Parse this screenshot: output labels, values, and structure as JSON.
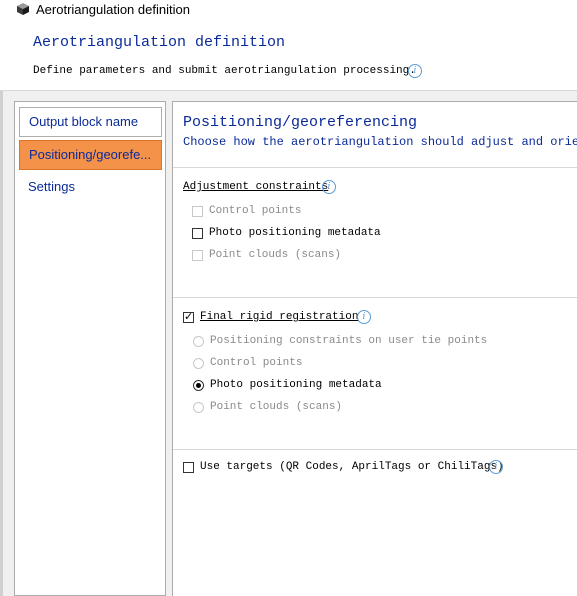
{
  "window": {
    "title": "Aerotriangulation definition"
  },
  "header": {
    "title": "Aerotriangulation definition",
    "subtitle": "Define parameters and submit aerotriangulation processing."
  },
  "sidebar": {
    "items": [
      {
        "label": "Output block name"
      },
      {
        "label": "Positioning/georefe..."
      },
      {
        "label": "Settings"
      }
    ]
  },
  "page": {
    "title": "Positioning/georeferencing",
    "subtitle": "Choose how the aerotriangulation should adjust and orient"
  },
  "adjustment": {
    "label": "Adjustment constraints",
    "options": [
      {
        "label": "Control points",
        "checked": false,
        "enabled": false
      },
      {
        "label": "Photo positioning metadata",
        "checked": false,
        "enabled": true
      },
      {
        "label": "Point clouds (scans)",
        "checked": false,
        "enabled": false
      }
    ]
  },
  "final_registration": {
    "label": "Final rigid registration",
    "checked": true,
    "options": [
      {
        "label": "Positioning constraints on user tie points",
        "selected": false,
        "enabled": false
      },
      {
        "label": "Control points",
        "selected": false,
        "enabled": false
      },
      {
        "label": "Photo positioning metadata",
        "selected": true,
        "enabled": true
      },
      {
        "label": "Point clouds (scans)",
        "selected": false,
        "enabled": false
      }
    ]
  },
  "targets": {
    "label": "Use targets (QR Codes, AprilTags or ChiliTags)",
    "checked": false
  },
  "icons": {
    "info": "info-icon",
    "app": "cube-app-icon"
  },
  "colors": {
    "accent": "#0b2a9a",
    "active_item": "#f5924a",
    "info": "#5b9bd5"
  }
}
